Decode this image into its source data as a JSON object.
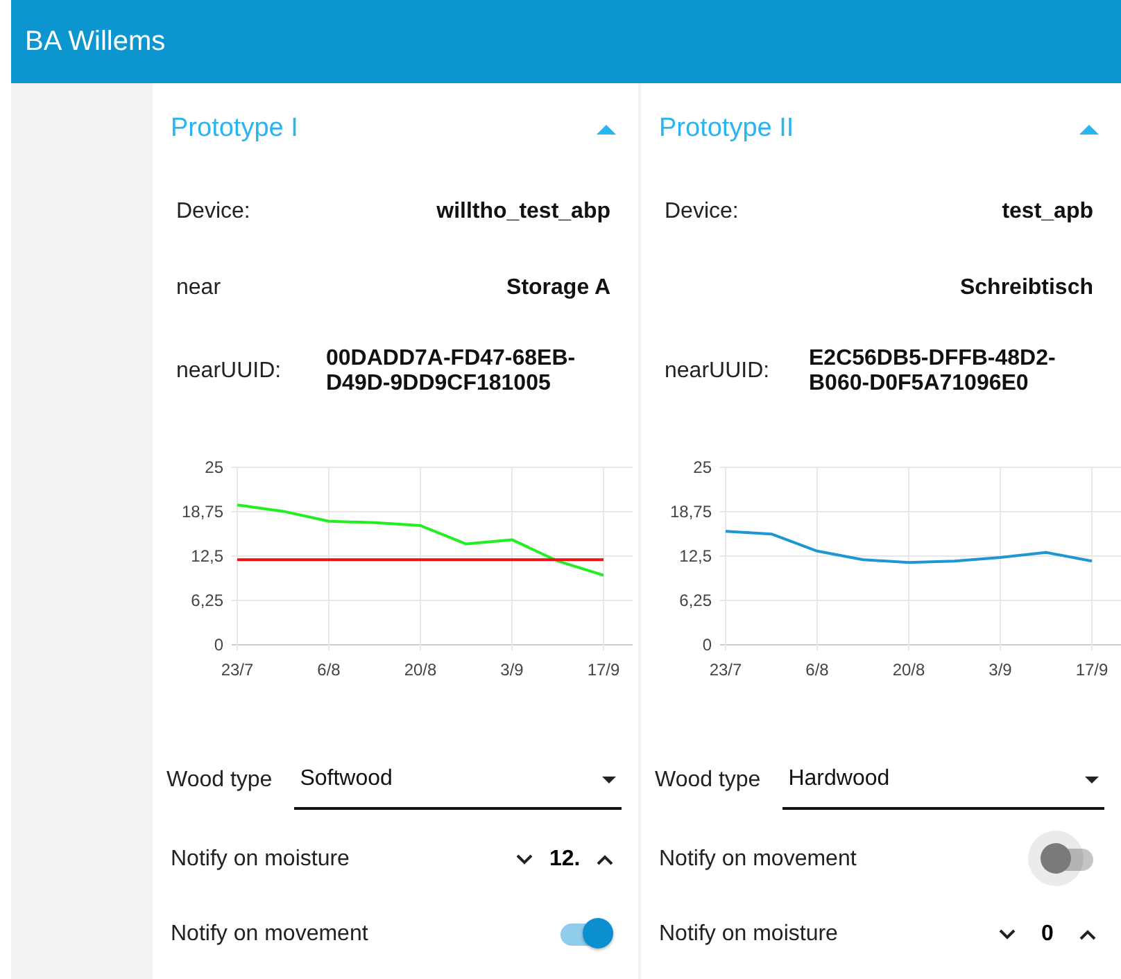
{
  "header": {
    "title": "BA Willems"
  },
  "cards": [
    {
      "title": "Prototype I",
      "expanded": true,
      "rows": [
        {
          "label": "Device:",
          "value": "willtho_test_abp"
        },
        {
          "label": "near",
          "value": "Storage A"
        },
        {
          "label": "nearUUID:",
          "value": "00DADD7A-FD47-68EB-D49D-9DD9CF181005"
        }
      ],
      "chart_data": {
        "type": "line",
        "categories": [
          "23/7",
          null,
          "6/8",
          null,
          "20/8",
          null,
          "3/9",
          null,
          "17/9",
          null
        ],
        "ylim": [
          0,
          25
        ],
        "yticks": [
          {
            "value": 0,
            "label": "0"
          },
          {
            "value": 6.25,
            "label": "6,25"
          },
          {
            "value": 12.5,
            "label": "12,5"
          },
          {
            "value": 18.75,
            "label": "18,75"
          },
          {
            "value": 25,
            "label": "25"
          }
        ],
        "grid": true,
        "series": [
          {
            "color": "#22ee22",
            "values": [
              19.7,
              18.8,
              17.4,
              17.2,
              16.8,
              14.2,
              14.8,
              11.8,
              9.8,
              null
            ]
          },
          {
            "color": "#ee1111",
            "values": [
              12,
              12,
              12,
              12,
              12,
              12,
              12,
              12,
              12,
              null
            ]
          }
        ]
      },
      "wood_type": {
        "label": "Wood type",
        "value": "Softwood"
      },
      "controls": [
        {
          "kind": "stepper",
          "label": "Notify on moisture",
          "value": "12."
        },
        {
          "kind": "toggle",
          "label": "Notify on movement",
          "on": true
        }
      ]
    },
    {
      "title": "Prototype II",
      "expanded": true,
      "rows": [
        {
          "label": "Device:",
          "value": "test_apb"
        },
        {
          "value": "Schreibtisch"
        },
        {
          "label": "nearUUID:",
          "value": "E2C56DB5-DFFB-48D2-B060-D0F5A71096E0"
        }
      ],
      "chart_data": {
        "type": "line",
        "categories": [
          "23/7",
          null,
          "6/8",
          null,
          "20/8",
          null,
          "3/9",
          null,
          "17/9",
          null
        ],
        "ylim": [
          0,
          25
        ],
        "yticks": [
          {
            "value": 0,
            "label": "0"
          },
          {
            "value": 6.25,
            "label": "6,25"
          },
          {
            "value": 12.5,
            "label": "12,5"
          },
          {
            "value": 18.75,
            "label": "18,75"
          },
          {
            "value": 25,
            "label": "25"
          }
        ],
        "grid": true,
        "series": [
          {
            "color": "#1e96d2",
            "values": [
              16,
              15.6,
              13.2,
              12,
              11.6,
              11.8,
              12.3,
              13,
              11.8,
              null
            ]
          }
        ]
      },
      "wood_type": {
        "label": "Wood type",
        "value": "Hardwood"
      },
      "controls": [
        {
          "kind": "toggle",
          "label": "Notify on movement",
          "on": false
        },
        {
          "kind": "stepper",
          "label": "Notify on moisture",
          "value": "0"
        }
      ]
    }
  ]
}
